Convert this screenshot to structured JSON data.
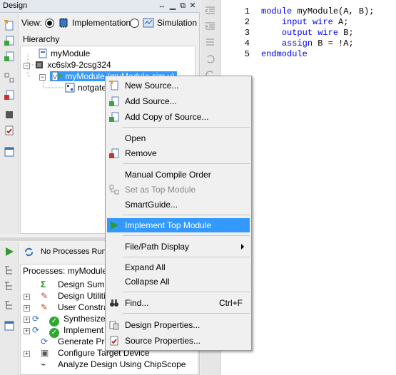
{
  "design_panel": {
    "title": "Design",
    "view_label": "View:",
    "view_options": [
      "Implementation",
      "Simulation"
    ],
    "view_selected": "Implementation",
    "hierarchy_label": "Hierarchy",
    "tree": [
      {
        "label": "myModule",
        "icon": "project-icon"
      },
      {
        "label": "xc6slx9-2csg324",
        "icon": "chip-icon"
      },
      {
        "label": "myModule (myModule.sim.v)",
        "icon": "verilog-module-icon",
        "selected": true
      },
      {
        "label": "notgate",
        "icon": "instance-icon"
      }
    ]
  },
  "processes": {
    "status": "No Processes Running",
    "label": "Processes: myModule",
    "items": [
      {
        "label": "Design Summary/Reports",
        "icon": "sigma-icon"
      },
      {
        "label": "Design Utilities",
        "icon": "tools-icon"
      },
      {
        "label": "User Constraints",
        "icon": "constraints-icon"
      },
      {
        "label": "Synthesize - XST",
        "icon": "check-ok-icon"
      },
      {
        "label": "Implement Design",
        "icon": "check-ok-icon"
      },
      {
        "label": "Generate Programming File",
        "icon": "bitfile-icon"
      },
      {
        "label": "Configure Target Device",
        "icon": "device-config-icon"
      },
      {
        "label": "Analyze Design Using ChipScope",
        "icon": "chipscope-icon"
      }
    ]
  },
  "editor": {
    "lines": [
      {
        "num": "1",
        "text": "module myModule(A, B);"
      },
      {
        "num": "2",
        "text": "    input wire A;"
      },
      {
        "num": "3",
        "text": "    output wire B;"
      },
      {
        "num": "4",
        "text": "    assign B = !A;"
      },
      {
        "num": "5",
        "text": "endmodule"
      }
    ]
  },
  "context_menu": {
    "items": {
      "new_source": "New Source...",
      "add_source": "Add Source...",
      "add_copy": "Add Copy of Source...",
      "open": "Open",
      "remove": "Remove",
      "manual_compile": "Manual Compile Order",
      "set_top": "Set as Top Module",
      "smartguide": "SmartGuide...",
      "implement_top": "Implement Top Module",
      "file_path_display": "File/Path Display",
      "expand_all": "Expand All",
      "collapse_all": "Collapse All",
      "find": "Find...",
      "find_shortcut": "Ctrl+F",
      "design_properties": "Design Properties...",
      "source_properties": "Source Properties..."
    }
  },
  "colors": {
    "selection": "#3399ff",
    "keyword": "#0000ff",
    "panel_bg": "#f0f0f0"
  }
}
